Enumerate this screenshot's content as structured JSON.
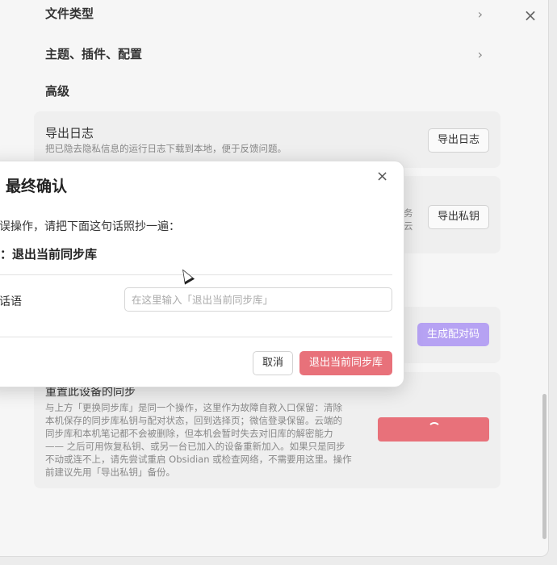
{
  "settings": {
    "close_icon": "×",
    "nav": [
      {
        "label": "文件类型",
        "chevron": "›"
      },
      {
        "label": "主题、插件、配置",
        "chevron": "›"
      }
    ],
    "section_advanced": "高级",
    "export_log": {
      "title": "导出日志",
      "desc": "把已隐去隐私信息的运行日志下载到本地，便于反馈问题。",
      "button": "导出日志"
    },
    "export_key": {
      "desc_fragment_1": "务",
      "desc_fragment_2": "云",
      "button": "导出私钥"
    },
    "pair": {
      "button": "生成配对码"
    },
    "reset": {
      "title": "重置此设备的同步",
      "desc_lines": [
        "与上方「更换同步库」是同一个操作，这里作为故障自救入口保留：清除",
        "本机保存的同步库私钥与配对状态，回到选择页；微信登录保留。云端的",
        "同步库和本机笔记都不会被删除，但本机会暂时失去对旧库的解密能力",
        "—— 之后可用恢复私钥、或另一台已加入的设备重新加入。如果只是同步",
        "不动或连不上，请先尝试重启 Obsidian 或检查网络，不需要用这里。操作",
        "前建议先用「导出私钥」备份。"
      ]
    }
  },
  "modal": {
    "title": "最终确认",
    "close_icon": "×",
    "instruction": "止误操作，请把下面这句话照抄一遍：",
    "phrase": "入：退出当前同步库",
    "input_label": "句话语",
    "input_placeholder": "在这里输入「退出当前同步库」",
    "input_value": "",
    "cancel": "取消",
    "confirm": "退出当前同步库"
  },
  "colors": {
    "accent_purple": "#b6a2f3",
    "danger_red": "#e8717a"
  }
}
